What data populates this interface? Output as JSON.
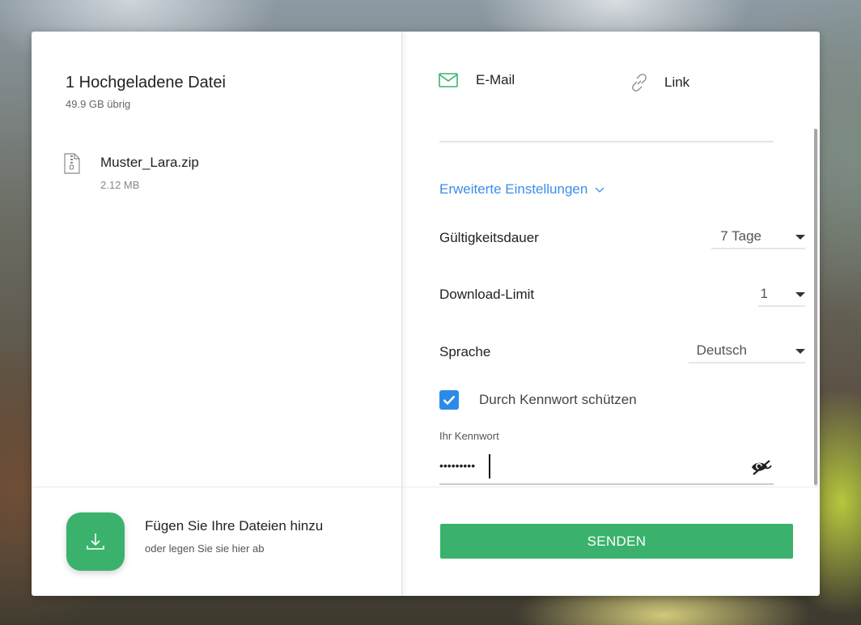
{
  "left": {
    "title": "1 Hochgeladene Datei",
    "storage": "49.9 GB übrig",
    "file": {
      "name": "Muster_Lara.zip",
      "size": "2.12 MB",
      "icon": "zip-file-icon"
    },
    "add": {
      "title": "Fügen Sie Ihre Dateien hinzu",
      "subtitle": "oder legen Sie sie hier ab",
      "icon": "download-icon"
    }
  },
  "right": {
    "tabs": [
      {
        "label": "E-Mail",
        "icon": "mail-icon",
        "active": true
      },
      {
        "label": "Link",
        "icon": "link-icon",
        "active": false
      }
    ],
    "advanced_label": "Erweiterte Einstellungen",
    "settings": {
      "validity": {
        "label": "Gültigkeitsdauer",
        "value": "7 Tage"
      },
      "download_limit": {
        "label": "Download-Limit",
        "value": "1"
      },
      "language": {
        "label": "Sprache",
        "value": "Deutsch"
      }
    },
    "password_protect": {
      "label": "Durch Kennwort schützen",
      "checked": true
    },
    "password": {
      "label": "Ihr Kennwort",
      "value": "•••••••••"
    },
    "send_label": "SENDEN"
  },
  "colors": {
    "accent_green": "#3ab26d",
    "link_blue": "#3b8eea",
    "checkbox_blue": "#2d8be8"
  }
}
